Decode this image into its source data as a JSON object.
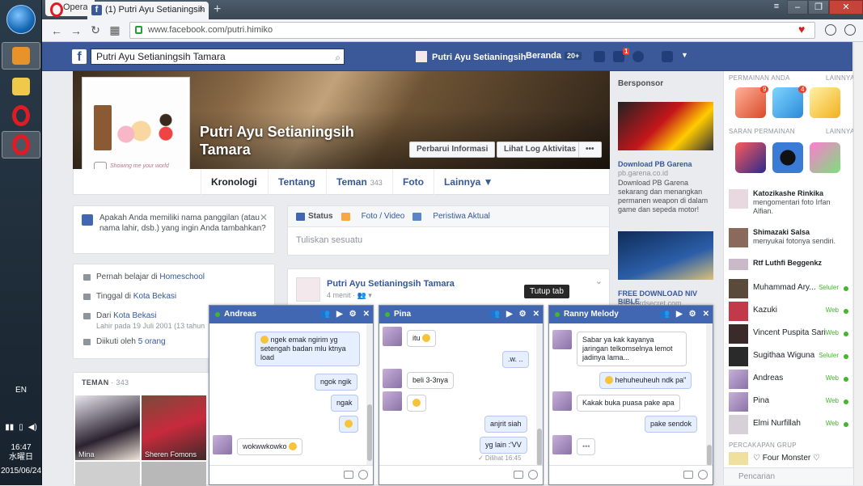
{
  "os": {
    "lang": "EN",
    "time": "16:47",
    "weekday": "水曜日",
    "date": "2015/06/24"
  },
  "browser": {
    "menu_label": "Opera",
    "tab_title": "(1) Putri Ayu Setianingsih Tamara",
    "tab_favicon": "f",
    "url": "www.facebook.com/putri.himiko"
  },
  "fb": {
    "search_value": "Putri Ayu Setianingsih Tamara",
    "nav_profile": "Putri Ayu Setianingsih",
    "nav_home": "Beranda",
    "nav_home_badge": "20+",
    "notif_badge": "1"
  },
  "profile": {
    "name": "Putri Ayu Setianingsih Tamara",
    "slogan": "Showing me your world",
    "btn_update": "Perbarui Informasi",
    "btn_activity": "Lihat Log Aktivitas",
    "btn_more": "•••",
    "tabs": {
      "timeline": "Kronologi",
      "about": "Tentang",
      "friends": "Teman",
      "friends_count": "343",
      "photos": "Foto",
      "more": "Lainnya ▼"
    }
  },
  "nickname_prompt": "Apakah Anda memiliki nama panggilan (atau nama lahir, dsb.) yang ingin Anda tambahkan?",
  "intro": {
    "study_prefix": "Pernah belajar di ",
    "study_link": "Homeschool",
    "lives_prefix": "Tinggal di ",
    "lives_link": "Kota Bekasi",
    "from_prefix": "Dari ",
    "from_link": "Kota Bekasi",
    "born": "Lahir pada 19 Juli 2001 (13 tahun",
    "followed_prefix": "Diikuti oleh ",
    "followed_link": "5 orang"
  },
  "friends_box": {
    "title": "TEMAN",
    "sep": " · ",
    "count": "343",
    "f1": "Mina",
    "f2": "Sheren Fomons"
  },
  "composer": {
    "status": "Status",
    "photo": "Foto / Video",
    "event": "Peristiwa Aktual",
    "placeholder": "Tuliskan sesuatu"
  },
  "post": {
    "author": "Putri Ayu Setianingsih Tamara",
    "time": "4 menit · 👥 ▾"
  },
  "sponsor": {
    "header": "Bersponsor",
    "ad1_title": "Download PB Garena",
    "ad1_domain": "pb.garena.co.id",
    "ad1_body": "Download PB Garena sekarang dan menangkan permanen weapon di dalam game dan sepeda motor!",
    "ad2_title": "FREE DOWNLOAD NIV BIBLE",
    "ad2_domain": "godwordsecret.com"
  },
  "right": {
    "games_header": "PERMAINAN ANDA",
    "more1": "LAINNYA",
    "suggest_header": "SARAN PERMAINAN",
    "more2": "LAINNYA",
    "badge1": "9",
    "badge2": "4",
    "ticker": [
      {
        "name": "Katozikashe Rinkika",
        "text": "mengomentari foto Irfan Alfian."
      },
      {
        "name": "Shimazaki Salsa",
        "text": "menyukai fotonya sendiri."
      },
      {
        "name": "Rtf Luthfi Beggenkz",
        "text": ""
      }
    ],
    "contacts": [
      {
        "name": "Muhammad Ary...",
        "status": "Seluler"
      },
      {
        "name": "Kazuki",
        "status": "Web"
      },
      {
        "name": "Vincent Puspita Sari",
        "status": "Web"
      },
      {
        "name": "Sugithaa Wiguna",
        "status": "Seluler"
      },
      {
        "name": "Andreas",
        "status": "Web"
      },
      {
        "name": "Pina",
        "status": "Web"
      },
      {
        "name": "Elmi Nurfillah",
        "status": "Web"
      }
    ],
    "group_header": "PERCAKAPAN GRUP",
    "group1": "♡ Four Monster ♡",
    "search_placeholder": "Pencarian"
  },
  "chats": {
    "tooltip": "Tutup tab",
    "andreas": {
      "title": "Andreas",
      "m1": "ngek emak ngirim yg setengah badan mlu ktnya load",
      "m2": "ngok ngik",
      "m3": "ngak",
      "m4": "wokwwkowko"
    },
    "pina": {
      "title": "Pina",
      "m1": "itu",
      "m2": ".w. ..",
      "m3": "beli 3-3nya",
      "m4": "anjrit siah",
      "m5": "yg lain :'VV",
      "seen": "✓ Dilihat 16:45"
    },
    "ranny": {
      "title": "Ranny Melody",
      "m1": "Sabar ya kak kayanya jaringan telkomselnya lemot jadinya lama...",
      "m2": "hehuheuheuh ndk pa\"",
      "m3": "Kakak buka puasa pake apa",
      "m4": "pake sendok",
      "m5": "•••"
    }
  },
  "colors": {
    "fb_blue": "#3b5998",
    "link": "#365899",
    "online": "#42b72a"
  }
}
